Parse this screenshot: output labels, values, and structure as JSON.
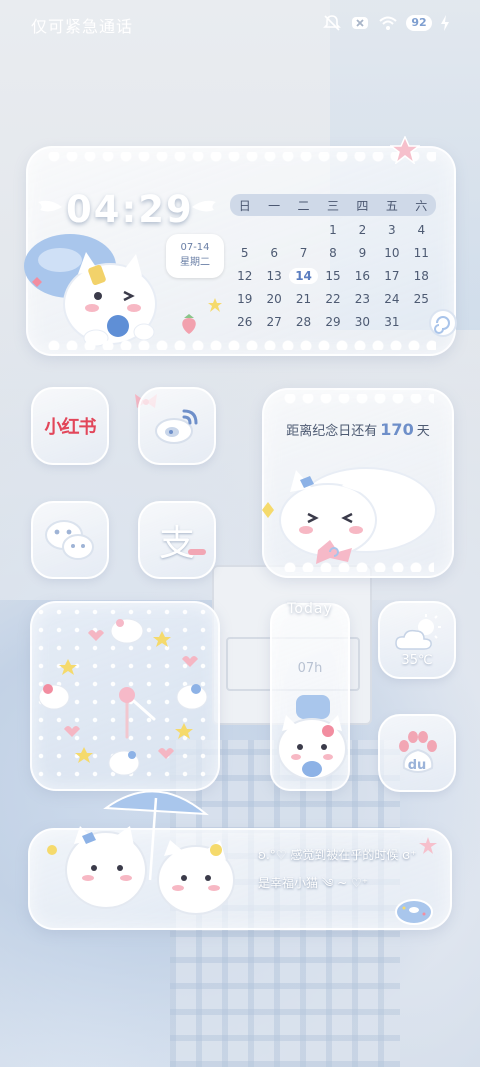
{
  "status_bar": {
    "carrier": "仅可紧急通话",
    "battery": "92",
    "icons": [
      "mute-icon",
      "no-signal-icon",
      "wifi-icon",
      "battery-icon",
      "charging-icon"
    ]
  },
  "clock_widget": {
    "time": "04:29",
    "date": "07-14",
    "weekday": "星期二",
    "calendar": {
      "weekdays": [
        "日",
        "一",
        "二",
        "三",
        "四",
        "五",
        "六"
      ],
      "days": [
        "",
        "",
        "",
        "1",
        "2",
        "3",
        "4",
        "5",
        "6",
        "7",
        "8",
        "9",
        "10",
        "11",
        "12",
        "13",
        "14",
        "15",
        "16",
        "17",
        "18",
        "19",
        "20",
        "21",
        "22",
        "23",
        "24",
        "25",
        "26",
        "27",
        "28",
        "29",
        "30",
        "31",
        ""
      ],
      "today": "14"
    }
  },
  "apps": {
    "xiaohongshu": "小红书",
    "weibo": "weibo-icon",
    "wechat": "wechat-icon",
    "alipay": "支"
  },
  "countdown_widget": {
    "prefix": "距离纪念日还有",
    "days": "170",
    "suffix": "天"
  },
  "today_widget": {
    "title": "Today",
    "hour": "07h"
  },
  "weather_widget": {
    "temperature": "35℃",
    "icon": "partly-cloudy-icon"
  },
  "baidu_app": {
    "label": "du"
  },
  "quote_widget": {
    "line1": "ʚ.°♡ 感觉到被在乎的时候 ɞ⁺",
    "line2": "是幸福小猫 ༄ ~ ♡⁺"
  },
  "colors": {
    "accent_blue": "#6e8fc9",
    "xiaohongshu_red": "#e2465a"
  }
}
